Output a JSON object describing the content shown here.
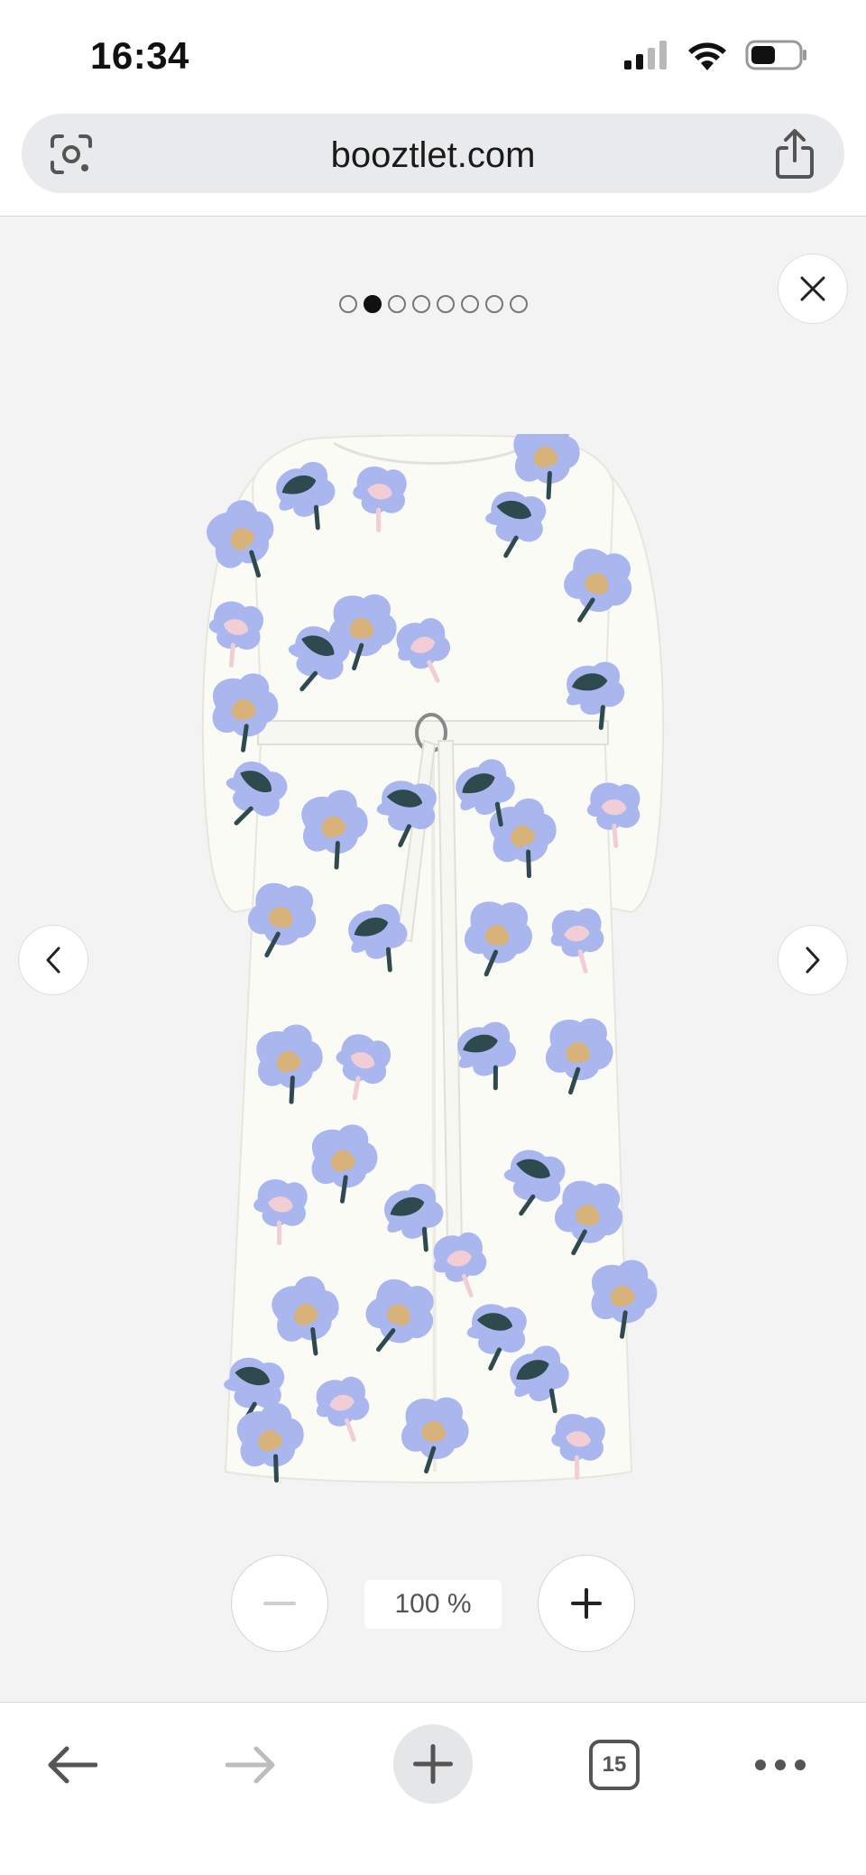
{
  "status_bar": {
    "time": "16:34",
    "icons": [
      "signal-icon",
      "wifi-icon",
      "battery-icon"
    ]
  },
  "browser": {
    "url": "booztlet.com",
    "icons": [
      "lens-icon",
      "share-icon"
    ]
  },
  "gallery": {
    "total_images": 8,
    "active_index": 1,
    "icons": [
      "close-icon",
      "chevron-left-icon",
      "chevron-right-icon"
    ],
    "image_alt": "product-photo"
  },
  "zoom": {
    "level": "100 %",
    "zoom_out_enabled": false
  },
  "toolbar": {
    "tab_count": "15",
    "forward_enabled": false,
    "icons": [
      "back-arrow-icon",
      "forward-arrow-icon",
      "plus-icon",
      "tabs-icon",
      "more-icon"
    ]
  },
  "colors": {
    "periwinkle": "#a9b7ee",
    "dark_teal": "#2f4a4e",
    "mustard": "#d7b27a",
    "blush": "#f1cdd6",
    "dress_white": "#fbfbf6"
  }
}
